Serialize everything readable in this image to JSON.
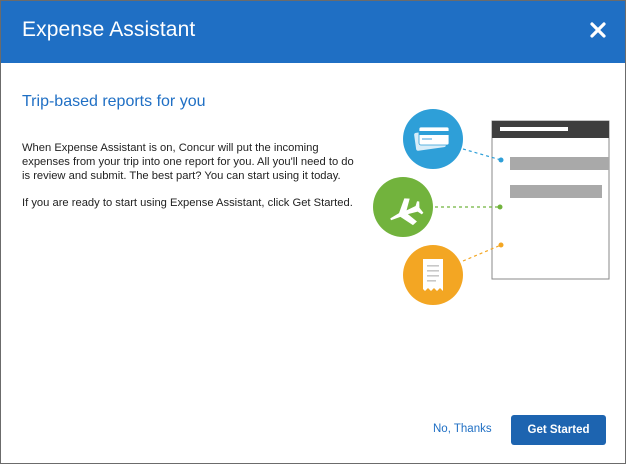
{
  "dialog": {
    "title": "Expense Assistant",
    "close_icon": "close-icon",
    "heading": "Trip-based reports for you",
    "paragraph_1": "When Expense Assistant is on, Concur will put the incoming expenses from your trip into one report for you. All you'll need to do is review and submit. The best part? You can start using it today.",
    "paragraph_2": "If you are ready to start using Expense Assistant, click Get Started.",
    "decline_label": "No, Thanks",
    "accept_label": "Get Started"
  },
  "illustration": {
    "icons": [
      "credit-card-icon",
      "airplane-icon",
      "receipt-icon"
    ]
  },
  "colors": {
    "header": "#1f6fc4",
    "card_circle": "#2e9fd8",
    "airplane_circle": "#72b33d",
    "receipt_circle": "#f3a623",
    "primary_button": "#1d64b0"
  }
}
